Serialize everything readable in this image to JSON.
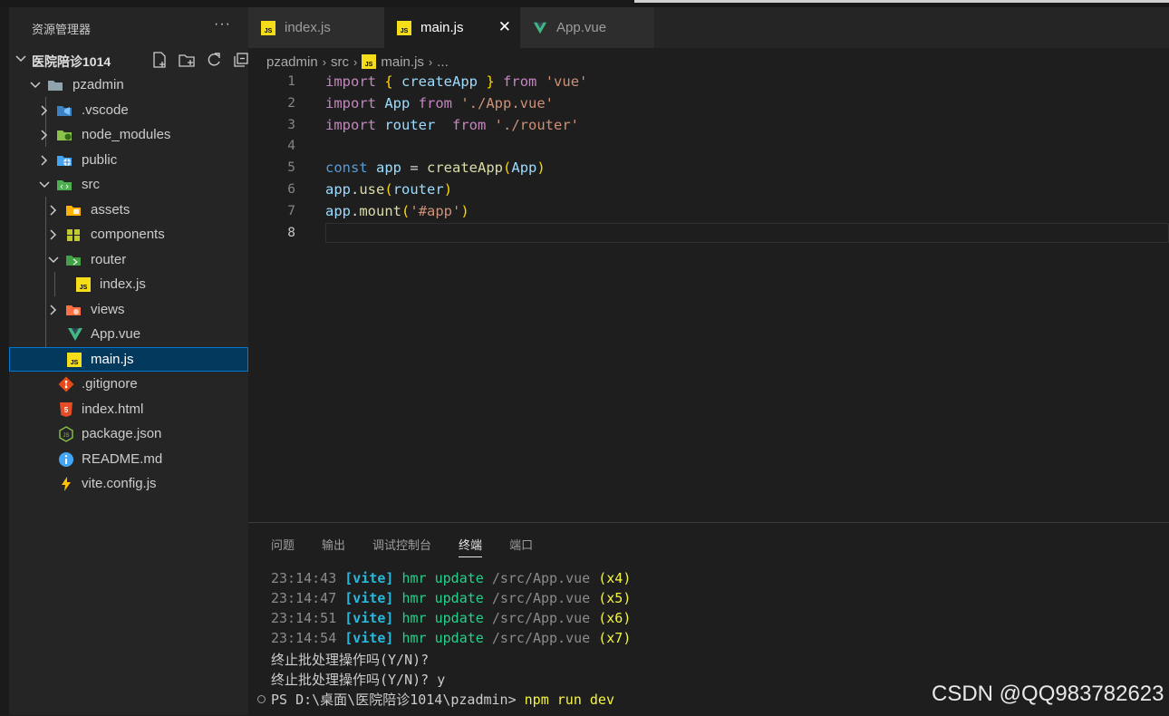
{
  "explorer": {
    "header": "资源管理器",
    "more": "···",
    "root": "医院陪诊1014",
    "tree": [
      {
        "label": "pzadmin",
        "icon": "folder-icon"
      },
      {
        "label": ".vscode",
        "icon": "vscode-folder-icon"
      },
      {
        "label": "node_modules",
        "icon": "node-folder-icon"
      },
      {
        "label": "public",
        "icon": "public-folder-icon"
      },
      {
        "label": "src",
        "icon": "src-folder-icon"
      },
      {
        "label": "assets",
        "icon": "assets-folder-icon"
      },
      {
        "label": "components",
        "icon": "components-folder-icon"
      },
      {
        "label": "router",
        "icon": "router-folder-icon"
      },
      {
        "label": "index.js",
        "icon": "js-file-icon"
      },
      {
        "label": "views",
        "icon": "views-folder-icon"
      },
      {
        "label": "App.vue",
        "icon": "vue-file-icon"
      },
      {
        "label": "main.js",
        "icon": "js-file-icon"
      },
      {
        "label": ".gitignore",
        "icon": "git-file-icon"
      },
      {
        "label": "index.html",
        "icon": "html-file-icon"
      },
      {
        "label": "package.json",
        "icon": "nodejs-file-icon"
      },
      {
        "label": "README.md",
        "icon": "info-file-icon"
      },
      {
        "label": "vite.config.js",
        "icon": "vite-file-icon"
      }
    ]
  },
  "tabs": [
    {
      "label": "index.js",
      "icon": "js-file-icon"
    },
    {
      "label": "main.js",
      "icon": "js-file-icon"
    },
    {
      "label": "App.vue",
      "icon": "vue-file-icon"
    }
  ],
  "tab_close": "✕",
  "breadcrumb": {
    "parts": [
      "pzadmin",
      "src",
      "main.js",
      "..."
    ],
    "sep": "›"
  },
  "code": {
    "line_numbers": [
      "1",
      "2",
      "3",
      "4",
      "5",
      "6",
      "7",
      "8"
    ],
    "lines": [
      [
        "import",
        " ",
        "{",
        " createApp ",
        "}",
        " ",
        "from",
        " ",
        "'vue'"
      ],
      [
        "import",
        " App ",
        "from",
        " ",
        "'./App.vue'"
      ],
      [
        "import",
        " router  ",
        "from",
        " ",
        "'./router'"
      ],
      [],
      [
        "const",
        " ",
        "app",
        " = ",
        "createApp",
        "(",
        "App",
        ")"
      ],
      [
        "app",
        ".",
        "use",
        "(",
        "router",
        ")"
      ],
      [
        "app",
        ".",
        "mount",
        "(",
        "'#app'",
        ")"
      ],
      []
    ]
  },
  "panel": {
    "tabs": [
      "问题",
      "输出",
      "调试控制台",
      "终端",
      "端口"
    ],
    "active_tab": "终端"
  },
  "terminal": {
    "hmr": [
      {
        "time": "23:14:43",
        "tag": "[vite]",
        "msg": "hmr update",
        "path": "/src/App.vue",
        "count": "(x4)"
      },
      {
        "time": "23:14:47",
        "tag": "[vite]",
        "msg": "hmr update",
        "path": "/src/App.vue",
        "count": "(x5)"
      },
      {
        "time": "23:14:51",
        "tag": "[vite]",
        "msg": "hmr update",
        "path": "/src/App.vue",
        "count": "(x6)"
      },
      {
        "time": "23:14:54",
        "tag": "[vite]",
        "msg": "hmr update",
        "path": "/src/App.vue",
        "count": "(x7)"
      }
    ],
    "batch_prompt_1": "终止批处理操作吗(Y/N)?",
    "batch_prompt_2": "终止批处理操作吗(Y/N)? y",
    "ps_prompt": "PS D:\\桌面\\医院陪诊1014\\pzadmin>",
    "command": "npm run dev"
  },
  "watermark": "CSDN @QQ983782623",
  "colors": {
    "sidebar_bg": "#252526",
    "editor_bg": "#1e1e1e",
    "selection": "#04395e",
    "selection_border": "#0078d4",
    "keyword": "#569cd6",
    "keyword_control": "#c586c0",
    "string": "#ce9178",
    "function": "#dcdcaa",
    "variable": "#9cdcfe"
  }
}
